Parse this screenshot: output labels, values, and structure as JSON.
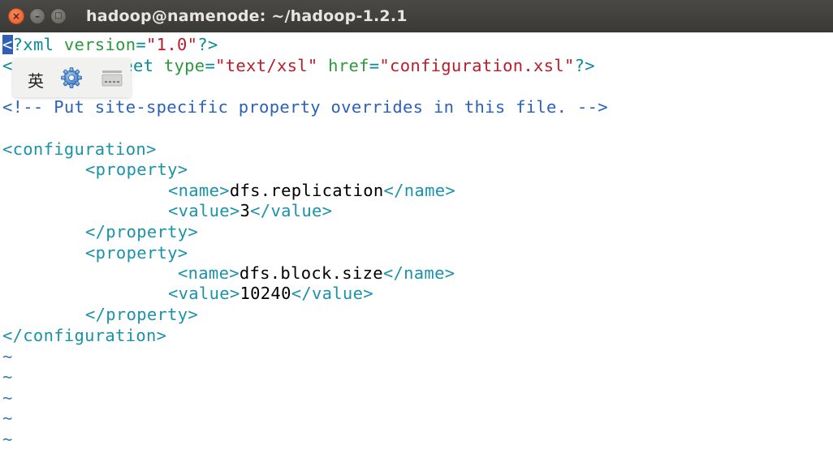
{
  "window": {
    "title": "hadoop@namenode: ~/hadoop-1.2.1",
    "buttons": {
      "close": "×",
      "minimize": "–",
      "maximize": "□"
    }
  },
  "ime": {
    "language": "英",
    "settings_icon": "gear-icon",
    "keyboard_icon": "keyboard-icon"
  },
  "editor": {
    "cursor_char": "<",
    "l1": {
      "rest": "?xml",
      "attr1": " version",
      "eq": "=",
      "val": "\"1.0\"",
      "end": "?>"
    },
    "l2": {
      "lt": "<",
      "visible": "heet",
      "attr1": " type",
      "eq1": "=",
      "val1": "\"text/xsl\"",
      "attr2": " href",
      "eq2": "=",
      "val2": "\"configuration.xsl\"",
      "end": "?>"
    },
    "comment": "<!-- Put site-specific property overrides in this file. -->",
    "open_configuration": "<configuration>",
    "open_property": "<property>",
    "open_name": "<name>",
    "close_name": "</name>",
    "open_value": "<value>",
    "close_value": "</value>",
    "close_property": "</property>",
    "close_configuration": "</configuration>",
    "properties": [
      {
        "name": "dfs.replication",
        "value": "3"
      },
      {
        "name": "dfs.block.size",
        "value": "10240"
      }
    ],
    "tilde": "~"
  }
}
